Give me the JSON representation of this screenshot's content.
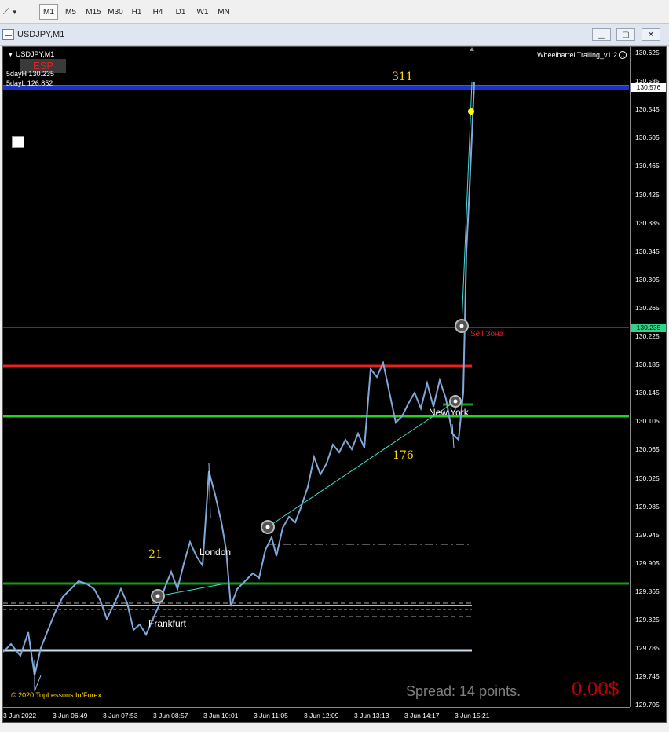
{
  "toolbar": {
    "timeframes": [
      "M1",
      "M5",
      "M15",
      "M30",
      "H1",
      "H4",
      "D1",
      "W1",
      "MN"
    ],
    "active_timeframe": "M1"
  },
  "window": {
    "title": "USDJPY,M1",
    "buttons": {
      "minimize": "minimize-icon",
      "restore": "restore-icon",
      "close": "close-icon"
    }
  },
  "chart": {
    "symbol_label": "USDJPY,M1",
    "esp_label": "ESP",
    "day_high": "5dayH 130.235",
    "day_low": "5dayL 126.852",
    "indicator_name": "Wheelbarrel Trailing_v1.2",
    "label_311": "311",
    "label_176": "176",
    "label_21": "21",
    "session_london": "London",
    "session_frankfurt": "Frankfurt",
    "session_newyork": "New York",
    "sell_zone": "Sell Зона",
    "copyright": "© 2020 TopLessons.In/Forex",
    "spread": "Spread: 14 points.",
    "profit": "0.00$",
    "price_labels": [
      "130.625",
      "130.585",
      "130.545",
      "130.505",
      "130.465",
      "130.425",
      "130.385",
      "130.345",
      "130.305",
      "130.265",
      "130.225",
      "130.185",
      "130.145",
      "130.105",
      "130.065",
      "130.025",
      "129.985",
      "129.945",
      "129.905",
      "129.865",
      "129.825",
      "129.785",
      "129.745",
      "129.705"
    ],
    "current_price_tag": "130.576",
    "zone_price_tag": "130.235",
    "time_labels": [
      "3 Jun 2022",
      "3 Jun 06:49",
      "3 Jun 07:53",
      "3 Jun 08:57",
      "3 Jun 10:01",
      "3 Jun 11:05",
      "3 Jun 12:09",
      "3 Jun 13:13",
      "3 Jun 14:17",
      "3 Jun 15:21"
    ],
    "colors": {
      "background": "#000000",
      "candles": "#7fa8d8",
      "blue_level": "#1e30c8",
      "red_level": "#e82020",
      "green_level": "#22d322",
      "dark_green_level": "#1a9a1a",
      "light_level": "#c8dce8",
      "zone_line": "#2fa37a",
      "yellow_labels": "#ffd700"
    }
  }
}
